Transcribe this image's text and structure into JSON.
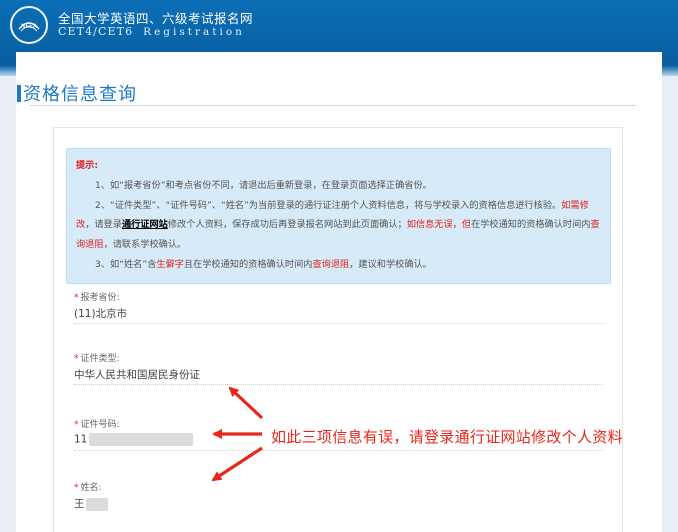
{
  "header": {
    "title_cn": "全国大学英语四、六级考试报名网",
    "title_en": "CET4/CET6",
    "title_en_sub": "Registration",
    "logo_text": "NEEA"
  },
  "page": {
    "title": "资格信息查询"
  },
  "notice": {
    "label": "提示:",
    "line1": "1、如“报考省份”和考点省份不同，请退出后重新登录，在登录页面选择正确省份。",
    "line2_a": "2、“证件类型”、“证件号码”、“姓名”为当前登录的通行证注册个人资料信息，将与学校录入的资格信息进行核验。",
    "line2_b": "如需修改",
    "line2_c": "，请登录",
    "line2_d": "通行证网站",
    "line2_e": "修改个人资料，保存成功后再登录报名网站到此页面确认；",
    "line2_f": "如信息无误，",
    "line2_g": "但",
    "line2_h": "在学校通知的资格确认时间内",
    "line2_i": "查询退阻",
    "line2_j": "，请联系学校确认。",
    "line3_a": "3、如“姓名”含",
    "line3_b": "生僻字",
    "line3_c": "且在学校通知的资格确认时间内",
    "line3_d": "查询退阻",
    "line3_e": "，建议和学校确认。"
  },
  "fields": {
    "province": {
      "label": "报考省份:",
      "value": "(11)北京市"
    },
    "id_type": {
      "label": "证件类型:",
      "value": "中华人民共和国居民身份证"
    },
    "id_number": {
      "label": "证件号码:",
      "value": "11"
    },
    "name": {
      "label": "姓名:",
      "value": "王"
    },
    "required_mark": "*"
  },
  "annotation": {
    "text": "如此三项信息有误，请登录通行证网站修改个人资料",
    "color": "#e8261c"
  },
  "colors": {
    "header_blue": "#0b6fb6",
    "title_blue": "#1f78c8",
    "notice_bg": "#d6eaf7",
    "required_red": "#e02020"
  },
  "icons": {
    "logo": "neea-logo-icon"
  }
}
